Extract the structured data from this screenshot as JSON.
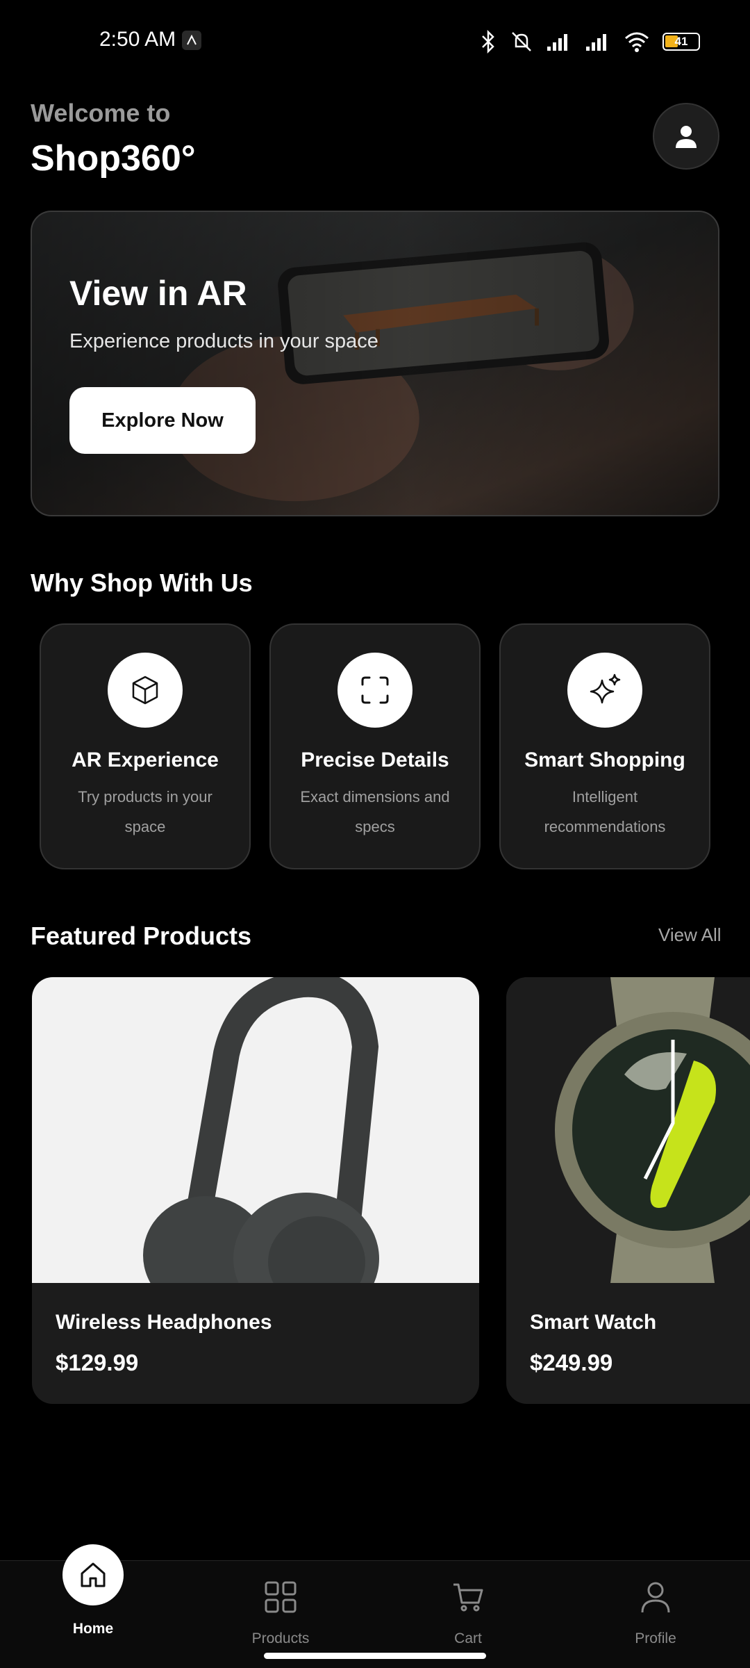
{
  "status_bar": {
    "time": "2:50 AM",
    "battery": "41"
  },
  "header": {
    "welcome": "Welcome to",
    "brand": "Shop360°"
  },
  "ar_banner": {
    "title": "View in AR",
    "subtitle": "Experience products in your space",
    "cta": "Explore Now"
  },
  "why_section": {
    "title": "Why Shop With Us",
    "features": [
      {
        "icon": "cube-icon",
        "title": "AR Experience",
        "desc": "Try products in your space"
      },
      {
        "icon": "scan-frame-icon",
        "title": "Precise Details",
        "desc": "Exact dimensions and specs"
      },
      {
        "icon": "sparkles-icon",
        "title": "Smart Shopping",
        "desc": "Intelligent recommendations"
      }
    ]
  },
  "featured": {
    "title": "Featured Products",
    "view_all": "View All",
    "products": [
      {
        "name": "Wireless Headphones",
        "price": "$129.99"
      },
      {
        "name": "Smart Watch",
        "price": "$249.99"
      }
    ]
  },
  "nav": {
    "items": [
      {
        "label": "Home",
        "icon": "home-icon",
        "active": true
      },
      {
        "label": "Products",
        "icon": "grid-icon",
        "active": false
      },
      {
        "label": "Cart",
        "icon": "cart-icon",
        "active": false
      },
      {
        "label": "Profile",
        "icon": "user-icon",
        "active": false
      }
    ]
  },
  "colors": {
    "background": "#000000",
    "card": "#1a1a1a",
    "accent": "#ffffff",
    "muted": "#a0a0a0"
  }
}
